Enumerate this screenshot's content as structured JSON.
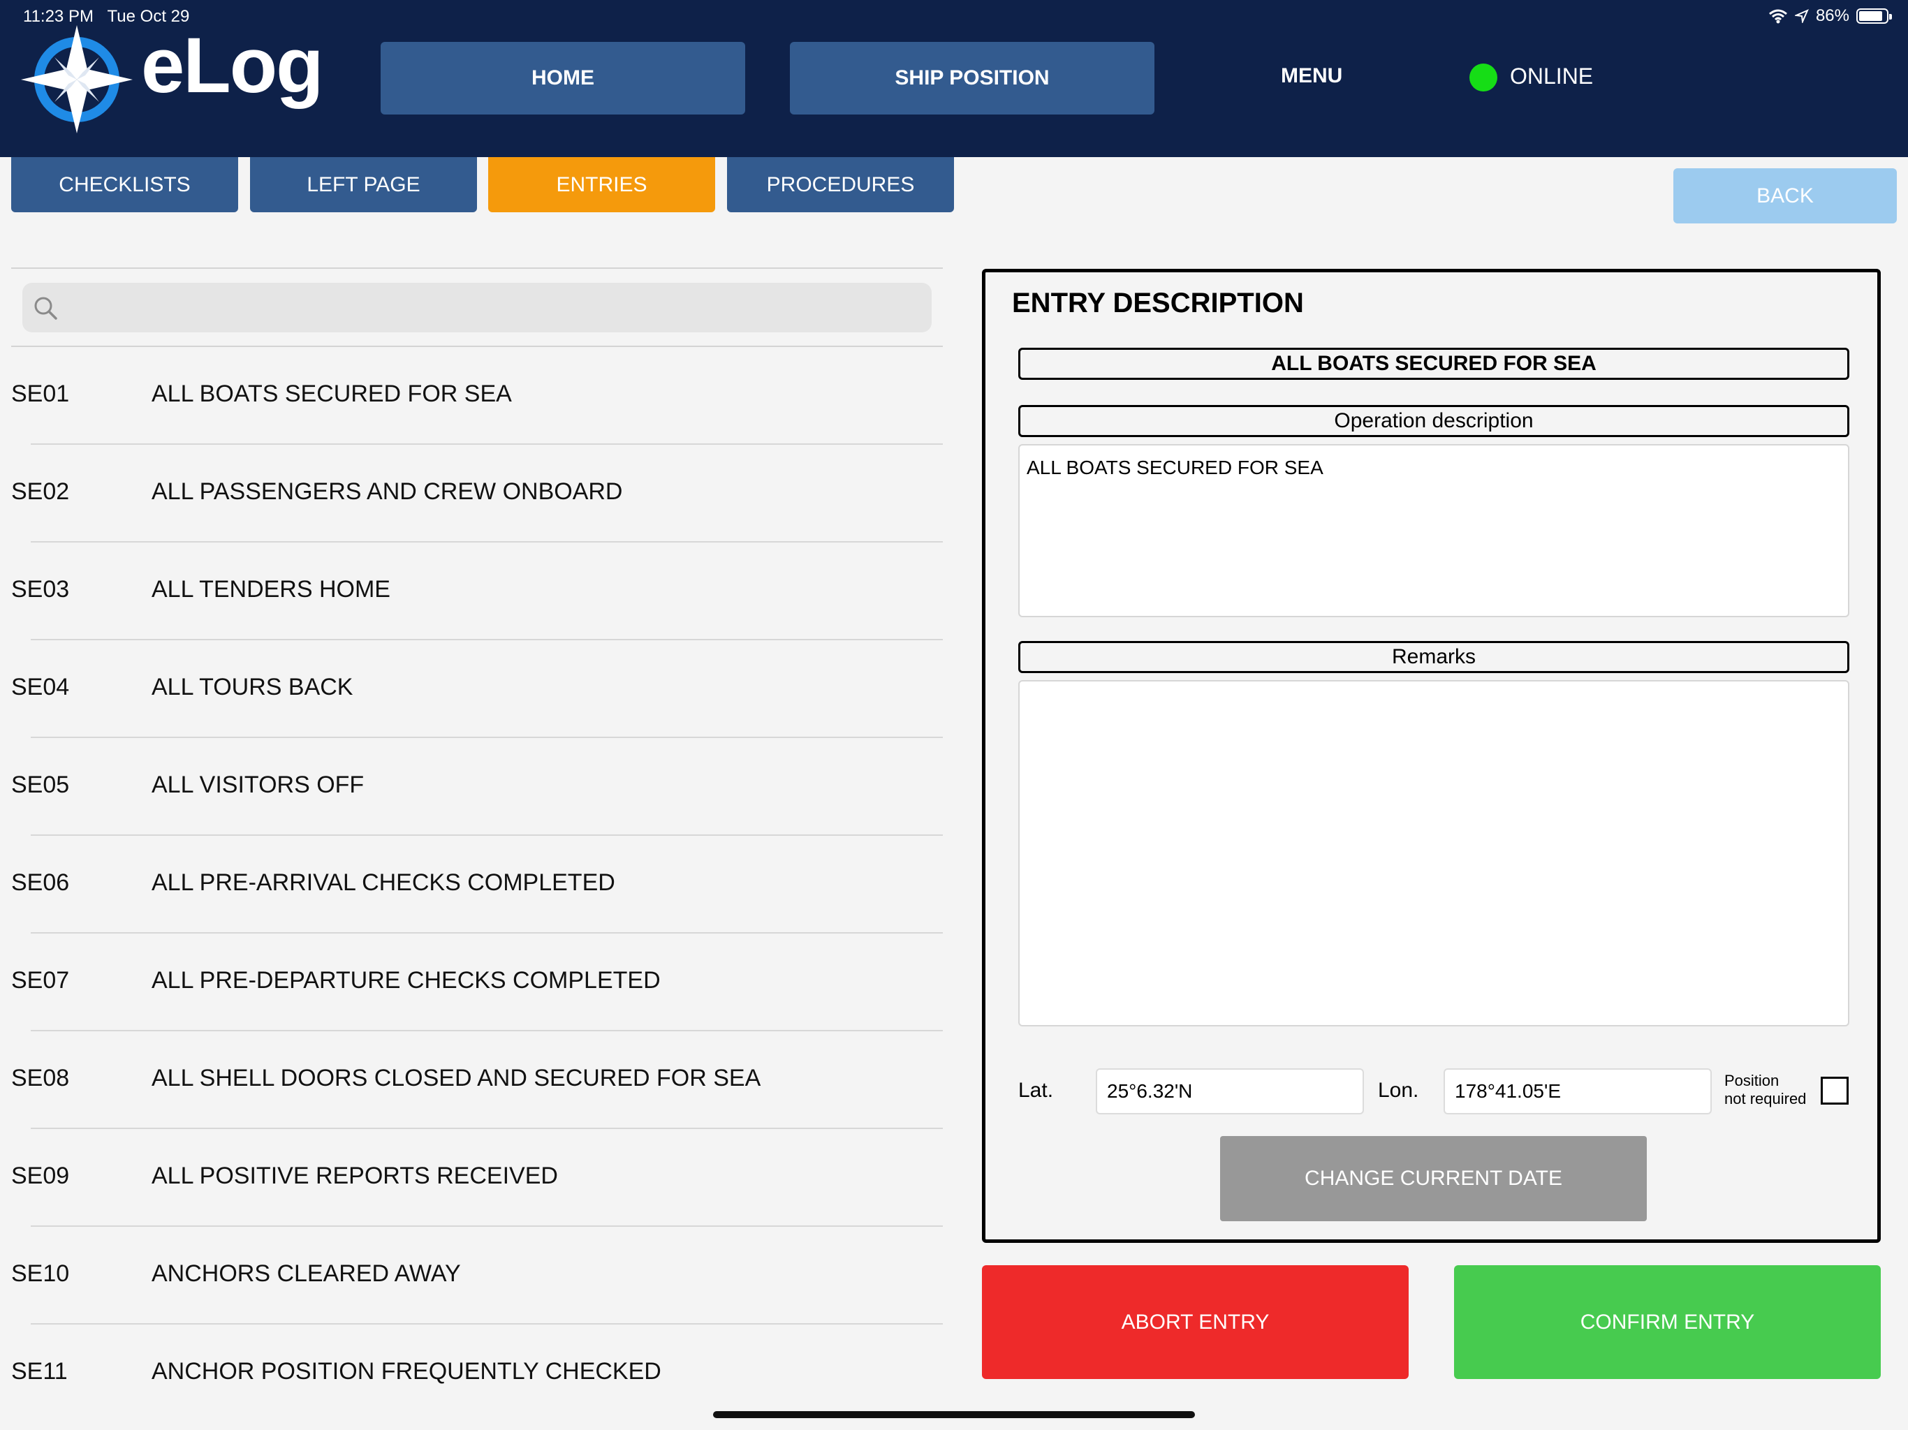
{
  "status_bar": {
    "time": "11:23 PM",
    "date": "Tue Oct 29",
    "battery": "86%",
    "battery_level": 0.86
  },
  "app": {
    "name": "eLog"
  },
  "header": {
    "home_label": "HOME",
    "ship_position_label": "SHIP POSITION",
    "menu_label": "MENU",
    "online_label": "ONLINE",
    "online_color": "#16dd16"
  },
  "tabs": [
    {
      "label": "CHECKLISTS",
      "active": false
    },
    {
      "label": "LEFT PAGE",
      "active": false
    },
    {
      "label": "ENTRIES",
      "active": true
    },
    {
      "label": "PROCEDURES",
      "active": false
    }
  ],
  "back_label": "BACK",
  "search": {
    "value": ""
  },
  "entries": [
    {
      "code": "SE01",
      "text": "ALL BOATS SECURED FOR SEA"
    },
    {
      "code": "SE02",
      "text": "ALL PASSENGERS AND CREW ONBOARD"
    },
    {
      "code": "SE03",
      "text": "ALL TENDERS HOME"
    },
    {
      "code": "SE04",
      "text": "ALL TOURS BACK"
    },
    {
      "code": "SE05",
      "text": "ALL VISITORS OFF"
    },
    {
      "code": "SE06",
      "text": "ALL PRE-ARRIVAL CHECKS COMPLETED"
    },
    {
      "code": "SE07",
      "text": "ALL PRE-DEPARTURE CHECKS COMPLETED"
    },
    {
      "code": "SE08",
      "text": "ALL SHELL DOORS CLOSED AND SECURED FOR SEA"
    },
    {
      "code": "SE09",
      "text": "ALL POSITIVE REPORTS RECEIVED"
    },
    {
      "code": "SE10",
      "text": "ANCHORS CLEARED AWAY"
    },
    {
      "code": "SE11",
      "text": "ANCHOR POSITION FREQUENTLY CHECKED"
    }
  ],
  "entry_panel": {
    "title": "ENTRY DESCRIPTION",
    "entry_name": "ALL BOATS SECURED FOR SEA",
    "operation_label": "Operation description",
    "operation_text": "ALL BOATS SECURED FOR SEA",
    "remarks_label": "Remarks",
    "remarks_text": "",
    "lat_label": "Lat.",
    "lat_value": "25°6.32'N",
    "lon_label": "Lon.",
    "lon_value": "178°41.05'E",
    "position_label_line1": "Position",
    "position_label_line2": "not required",
    "position_not_required": false,
    "change_date_label": "CHANGE CURRENT DATE"
  },
  "actions": {
    "abort_label": "ABORT ENTRY",
    "abort_color": "#ee2a2a",
    "confirm_label": "CONFIRM ENTRY",
    "confirm_color": "#47cb4f"
  },
  "colors": {
    "header_bg": "#0e2149",
    "nav_button": "#335b8f",
    "active_tab": "#f59a0c",
    "back_button": "#9ccbef"
  }
}
